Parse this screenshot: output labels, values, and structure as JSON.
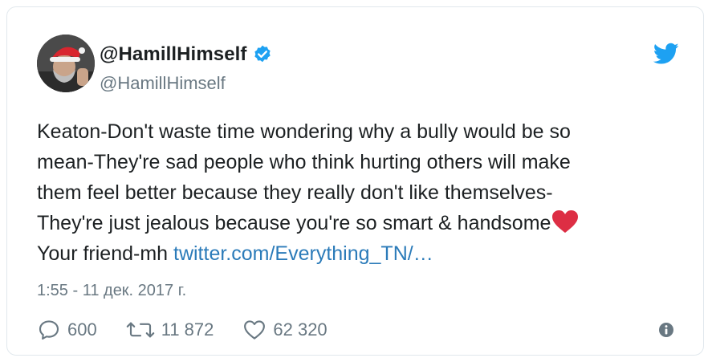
{
  "tweet": {
    "display_name": "@HamillHimself",
    "handle": "@HamillHimself",
    "text_lines": [
      "Keaton-Don't waste time wondering why a bully would be so",
      "mean-They're sad people who think hurting others will make",
      "them feel better because they really don't like themselves-",
      "They're just jealous because you're so smart & handsome",
      "Your friend-mh "
    ],
    "link_text": "twitter.com/Everything_TN/…",
    "timestamp": "1:55 - 11 дек. 2017 г.",
    "replies": "600",
    "retweets": "11 872",
    "likes": "62 320"
  },
  "icons": {
    "avatar": "avatar-photo",
    "verified": "verified-badge-icon",
    "brand": "twitter-bird-icon",
    "emoji": "red-heart-emoji",
    "reply": "reply-icon",
    "retweet": "retweet-icon",
    "like": "heart-icon",
    "info": "info-icon"
  },
  "colors": {
    "text": "#1c2022",
    "muted": "#697882",
    "link": "#2b7bb9",
    "brand_blue": "#1da1f2",
    "emoji_red": "#dd2e44"
  }
}
